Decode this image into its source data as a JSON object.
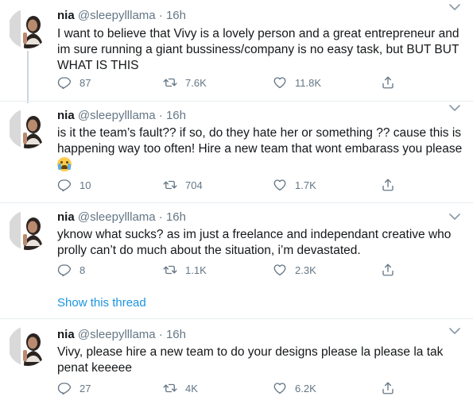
{
  "colors": {
    "accent": "#1b95e0",
    "secondary_text": "#657786",
    "divider": "#e6ecf0"
  },
  "tweets": [
    {
      "name": "nia",
      "handle": "@sleepylllama",
      "dot": "·",
      "time": "16h",
      "text": "I want to believe that Vivy is a lovely person and a great entrepreneur and im sure running a giant bussiness/company is no easy task, but BUT BUT WHAT IS THIS",
      "replies": "87",
      "retweets": "7.6K",
      "likes": "11.8K"
    },
    {
      "name": "nia",
      "handle": "@sleepylllama",
      "dot": "·",
      "time": "16h",
      "text": "is it the team’s fault?? if so, do they hate her or something ?? cause this is happening way too often! Hire a new team that wont embarass you please",
      "emoji": "loudly-crying-face",
      "replies": "10",
      "retweets": "704",
      "likes": "1.7K"
    },
    {
      "name": "nia",
      "handle": "@sleepylllama",
      "dot": "·",
      "time": "16h",
      "text": "yknow what sucks? as im just a freelance and independant creative who prolly can’t do much about the situation, i’m devastated.",
      "replies": "8",
      "retweets": "1.1K",
      "likes": "2.3K"
    },
    {
      "name": "nia",
      "handle": "@sleepylllama",
      "dot": "·",
      "time": "16h",
      "text": "Vivy, please hire a new team to do your designs please la please la tak penat keeeee",
      "replies": "27",
      "retweets": "4K",
      "likes": "6.2K"
    }
  ],
  "show_thread": "Show this thread"
}
